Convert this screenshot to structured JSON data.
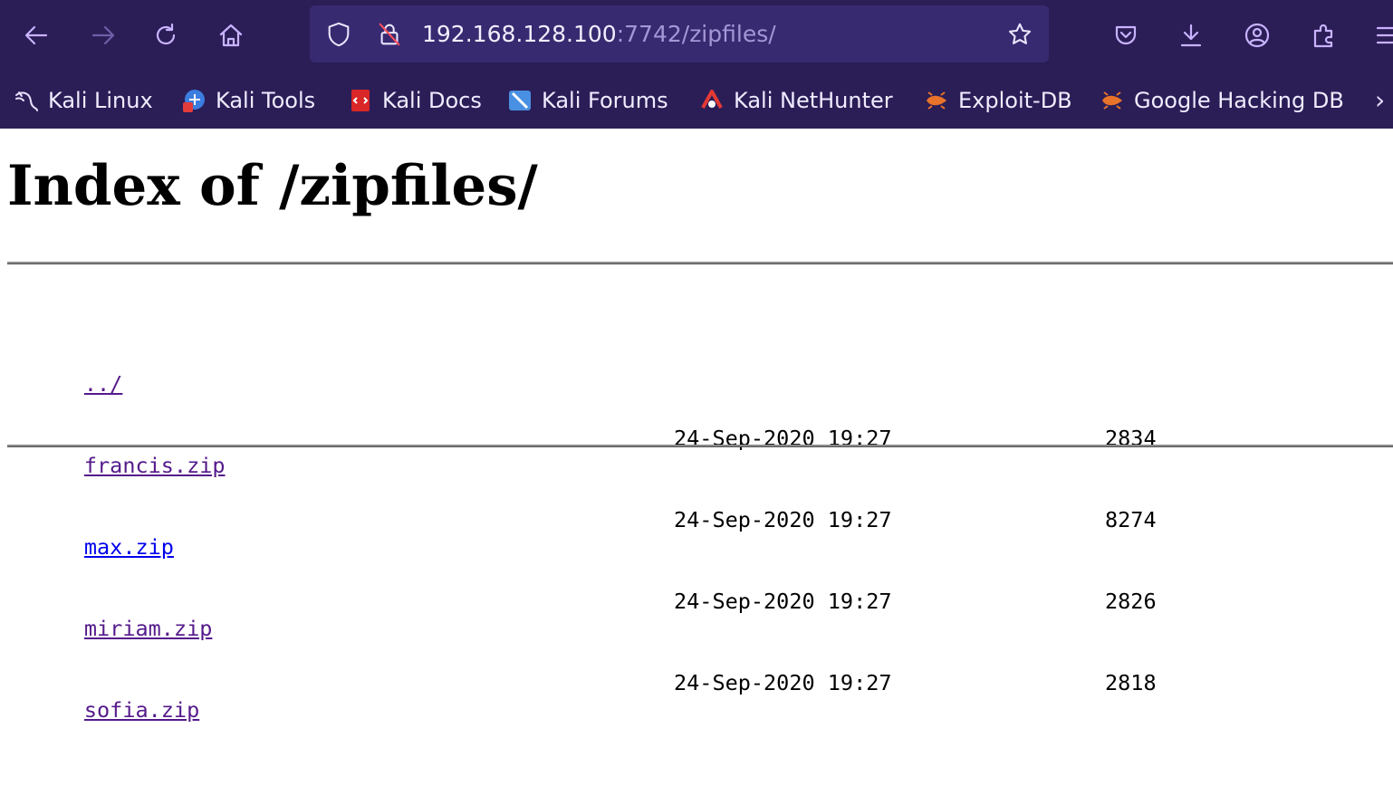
{
  "toolbar": {
    "buttons": [
      "back",
      "forward",
      "reload",
      "home"
    ],
    "url_host": "192.168.128.100",
    "url_path": ":7742/zipfiles/"
  },
  "bookmarks": [
    {
      "label": "Kali Linux",
      "icon": "kali-dragon-icon"
    },
    {
      "label": "Kali Tools",
      "icon": "kali-tools-icon"
    },
    {
      "label": "Kali Docs",
      "icon": "kali-docs-icon"
    },
    {
      "label": "Kali Forums",
      "icon": "kali-forums-icon"
    },
    {
      "label": "Kali NetHunter",
      "icon": "kali-nethunter-icon"
    },
    {
      "label": "Exploit-DB",
      "icon": "exploit-db-icon"
    },
    {
      "label": "Google Hacking DB",
      "icon": "exploit-db-icon"
    }
  ],
  "page": {
    "title": "Index of /zipfiles/",
    "parent_link": "../",
    "files": [
      {
        "name": "francis.zip",
        "date": "24-Sep-2020 19:27",
        "size": "2834",
        "visited": true
      },
      {
        "name": "max.zip",
        "date": "24-Sep-2020 19:27",
        "size": "8274",
        "visited": false
      },
      {
        "name": "miriam.zip",
        "date": "24-Sep-2020 19:27",
        "size": "2826",
        "visited": true
      },
      {
        "name": "sofia.zip",
        "date": "24-Sep-2020 19:27",
        "size": "2818",
        "visited": true
      }
    ]
  },
  "colors": {
    "chrome_bg": "#2b1e57",
    "urlbar_bg": "#372a70",
    "link": "#0000ee",
    "visited_link": "#551a8b"
  }
}
